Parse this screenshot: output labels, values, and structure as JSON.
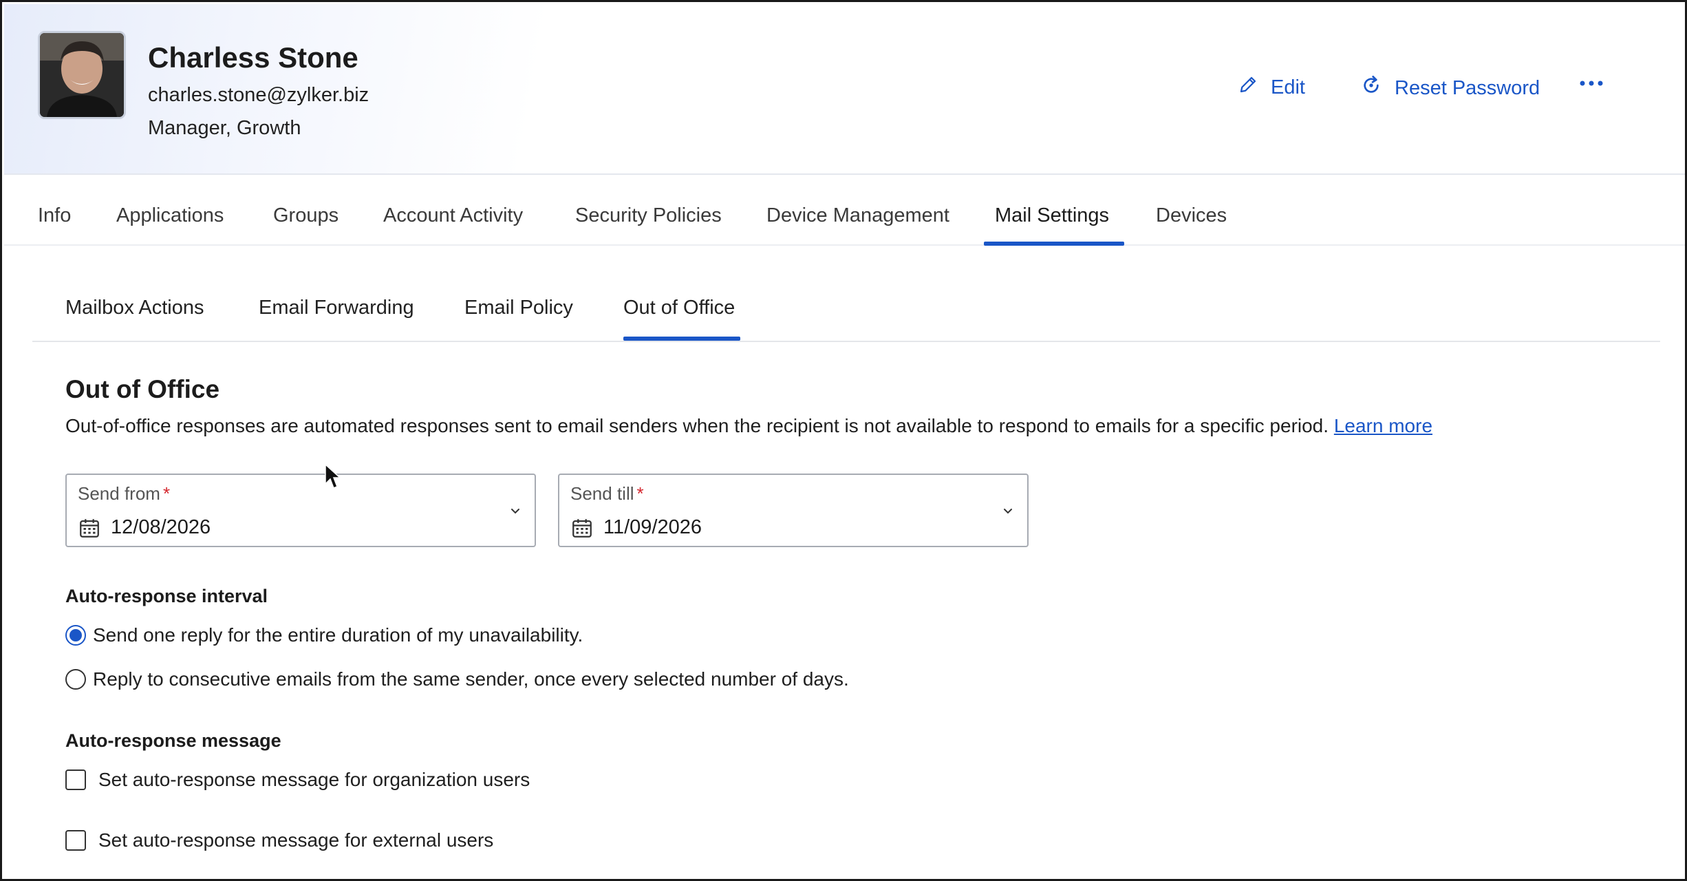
{
  "profile": {
    "name": "Charless Stone",
    "email": "charles.stone@zylker.biz",
    "role": "Manager, Growth"
  },
  "actions": {
    "edit": "Edit",
    "reset_password": "Reset Password"
  },
  "main_tabs": [
    {
      "label": "Info"
    },
    {
      "label": "Applications"
    },
    {
      "label": "Groups"
    },
    {
      "label": "Account Activity"
    },
    {
      "label": "Security Policies"
    },
    {
      "label": "Device Management"
    },
    {
      "label": "Mail Settings"
    },
    {
      "label": "Devices"
    }
  ],
  "main_tab_active": "Mail Settings",
  "sub_tabs": [
    {
      "label": "Mailbox Actions"
    },
    {
      "label": "Email Forwarding"
    },
    {
      "label": "Email Policy"
    },
    {
      "label": "Out of Office"
    }
  ],
  "sub_tab_active": "Out of Office",
  "ooo": {
    "title": "Out of Office",
    "description": "Out-of-office responses are automated responses sent to email senders when the recipient is not available to respond to emails for a specific period.",
    "learn_more": "Learn more",
    "send_from": {
      "label": "Send from",
      "required": "*",
      "value": "12/08/2026"
    },
    "send_till": {
      "label": "Send till",
      "required": "*",
      "value": "11/09/2026"
    },
    "interval": {
      "title": "Auto-response interval",
      "options": [
        {
          "label": "Send one reply for the entire duration of my unavailability.",
          "selected": true
        },
        {
          "label": "Reply to consecutive emails from the same sender, once every selected number of days.",
          "selected": false
        }
      ]
    },
    "message": {
      "title": "Auto-response message",
      "options": [
        {
          "label": "Set auto-response message for organization users",
          "checked": false
        },
        {
          "label": "Set auto-response message for external users",
          "checked": false
        }
      ]
    }
  },
  "colors": {
    "accent": "#1a56c7",
    "required": "#d4262d"
  },
  "icons": [
    "close-icon",
    "pencil-icon",
    "refresh-icon",
    "more-icon",
    "calendar-icon",
    "chevron-down-icon",
    "mouse-cursor-icon"
  ]
}
